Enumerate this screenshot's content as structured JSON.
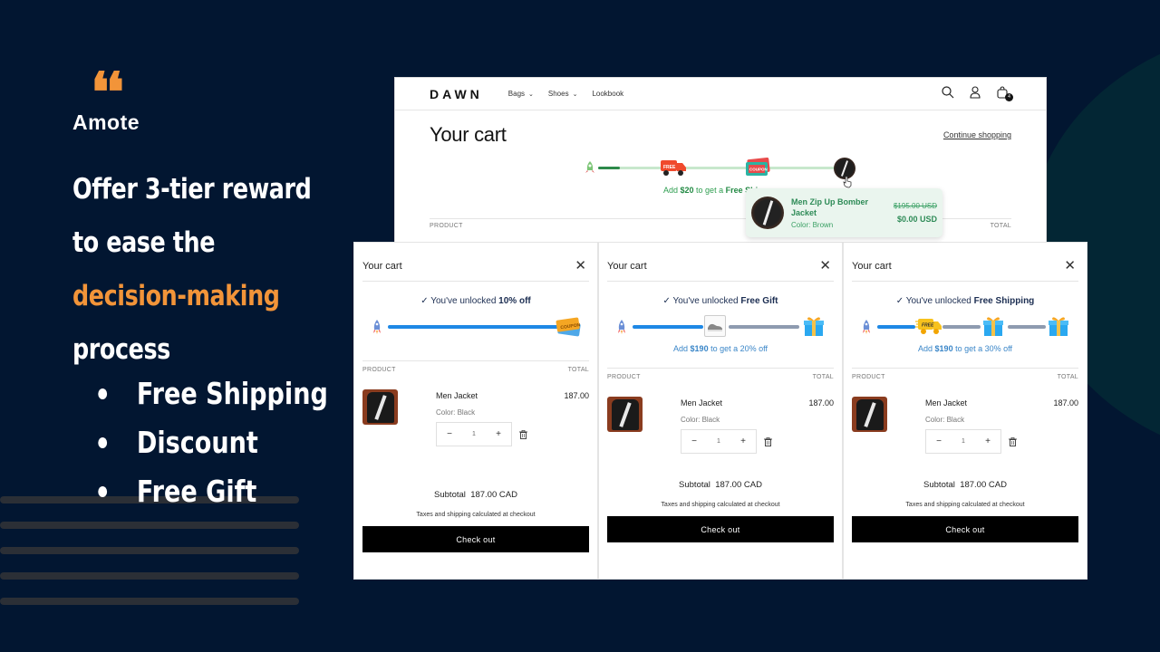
{
  "brand": {
    "name": "Amote",
    "quote_glyph": "❛❛"
  },
  "headline": {
    "line1": "Offer 3-tier reward",
    "line2": "to ease the",
    "accent": "decision-making",
    "line4": "process"
  },
  "bullets": [
    "Free Shipping",
    "Discount",
    "Free Gift"
  ],
  "colors": {
    "background": "#021631",
    "accent": "#f29439",
    "progress_blue": "#1e88e5",
    "progress_green": "#2d8a4a"
  },
  "storefront": {
    "logo": "DAWN",
    "nav": [
      {
        "label": "Bags",
        "dropdown": true
      },
      {
        "label": "Shoes",
        "dropdown": true
      },
      {
        "label": "Lookbook",
        "dropdown": false
      }
    ],
    "cart_count": "4",
    "title": "Your cart",
    "continue_link": "Continue shopping",
    "progress": {
      "fraction_to_first_tier": 0.05
    },
    "hint": {
      "prefix": "Add ",
      "amount": "$20",
      "mid": " to get a ",
      "reward": "Free Shi"
    },
    "columns": {
      "product": "PRODUCT",
      "total": "TOTAL"
    },
    "tooltip": {
      "name": "Men Zip Up Bomber Jacket",
      "color": "Color: Brown",
      "old_price": "$195.00 USD",
      "new_price": "$0.00 USD"
    }
  },
  "drawers": [
    {
      "title": "Your cart",
      "unlock_prefix": "You've unlocked ",
      "unlock_reward": "10% off",
      "hint": null,
      "columns": {
        "product": "PRODUCT",
        "total": "TOTAL"
      },
      "item": {
        "name": "Men Jacket",
        "color": "Color: Black",
        "qty": "1",
        "price": "187.00"
      },
      "subtotal_label": "Subtotal",
      "subtotal_value": "187.00 CAD",
      "taxes": "Taxes and shipping calculated at checkout",
      "checkout": "Check out"
    },
    {
      "title": "Your cart",
      "unlock_prefix": "You've unlocked ",
      "unlock_reward": "Free Gift",
      "hint": {
        "prefix": "Add ",
        "amount": "$190",
        "suffix": " to get a 20% off"
      },
      "columns": {
        "product": "PRODUCT",
        "total": "TOTAL"
      },
      "item": {
        "name": "Men Jacket",
        "color": "Color: Black",
        "qty": "1",
        "price": "187.00"
      },
      "subtotal_label": "Subtotal",
      "subtotal_value": "187.00 CAD",
      "taxes": "Taxes and shipping calculated at checkout",
      "checkout": "Check out"
    },
    {
      "title": "Your cart",
      "unlock_prefix": "You've unlocked ",
      "unlock_reward": "Free Shipping",
      "hint": {
        "prefix": "Add ",
        "amount": "$190",
        "suffix": " to get a 30% off"
      },
      "columns": {
        "product": "PRODUCT",
        "total": "TOTAL"
      },
      "item": {
        "name": "Men Jacket",
        "color": "Color: Black",
        "qty": "1",
        "price": "187.00"
      },
      "subtotal_label": "Subtotal",
      "subtotal_value": "187.00 CAD",
      "taxes": "Taxes and shipping calculated at checkout",
      "checkout": "Check out"
    }
  ]
}
